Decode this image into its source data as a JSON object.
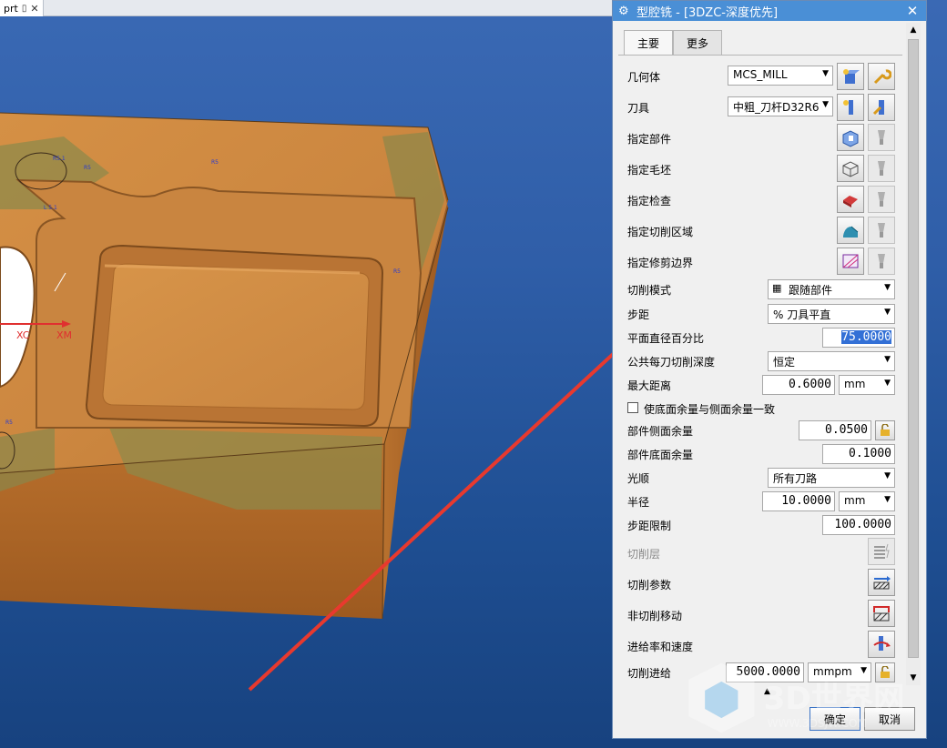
{
  "document": {
    "tab_label": "prt"
  },
  "viewport": {
    "axis_labels": {
      "xc": "XC",
      "xm": "XM"
    },
    "dimension_labels": [
      "R5.1",
      "R5",
      "R5",
      "L 5.1",
      "R5",
      "R5"
    ]
  },
  "dialog": {
    "title": "型腔铣 - [3DZC-深度优先]",
    "tabs": [
      "主要",
      "更多"
    ],
    "geometry": {
      "label": "几何体",
      "value": "MCS_MILL"
    },
    "tool": {
      "label": "刀具",
      "value": "中粗_刀杆D32R6"
    },
    "specify_part": "指定部件",
    "specify_blank": "指定毛坯",
    "specify_check": "指定检查",
    "specify_cut_area": "指定切削区域",
    "specify_trim": "指定修剪边界",
    "cut_pattern": {
      "label": "切削模式",
      "value": "跟随部件"
    },
    "stepover": {
      "label": "步距",
      "value": "% 刀具平直"
    },
    "percent_flat": {
      "label": "平面直径百分比",
      "value": "75.0000"
    },
    "depth_per_cut": {
      "label": "公共每刀切削深度",
      "value": "恒定"
    },
    "max_distance": {
      "label": "最大距离",
      "value": "0.6000",
      "unit": "mm"
    },
    "floor_same_as_side": {
      "label": "使底面余量与侧面余量一致",
      "checked": false
    },
    "part_side_stock": {
      "label": "部件侧面余量",
      "value": "0.0500"
    },
    "part_floor_stock": {
      "label": "部件底面余量",
      "value": "0.1000"
    },
    "smoothing": {
      "label": "光顺",
      "value": "所有刀路"
    },
    "radius": {
      "label": "半径",
      "value": "10.0000",
      "unit": "mm"
    },
    "stepover_limit": {
      "label": "步距限制",
      "value": "100.0000"
    },
    "cut_levels": "切削层",
    "cut_params": "切削参数",
    "non_cut_moves": "非切削移动",
    "feeds_speeds": "进给率和速度",
    "cut_feed": {
      "label": "切削进给",
      "value": "5000.0000",
      "unit": "mmpm"
    },
    "ok": "确定",
    "cancel": "取消"
  },
  "watermark": {
    "title": "3D世界网",
    "url": "WWW.3DSJW.COM"
  },
  "colors": {
    "titlebar": "#4a8fd6",
    "part_orange": "#d28a3f",
    "annotation_arrow": "#e8392e"
  }
}
